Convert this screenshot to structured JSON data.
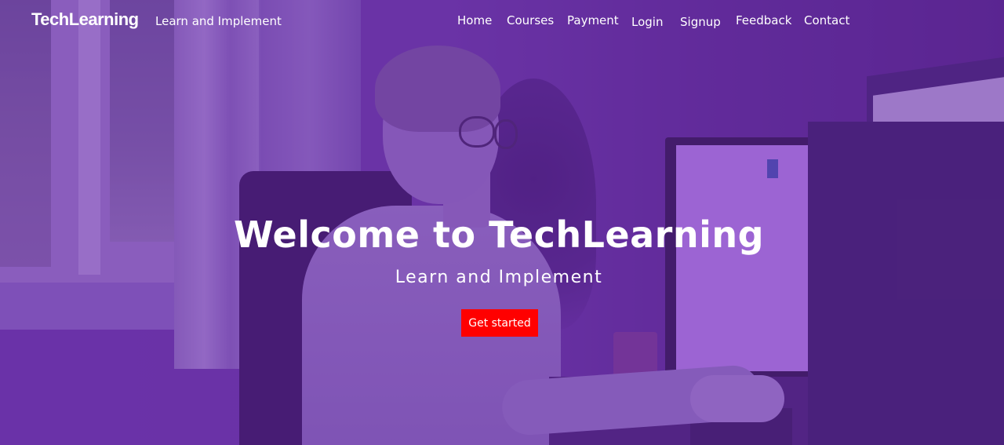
{
  "brand": {
    "name": "TechLearning",
    "tagline": "Learn and Implement"
  },
  "nav": {
    "items": [
      {
        "label": "Home"
      },
      {
        "label": "Courses"
      },
      {
        "label": "Payment"
      },
      {
        "label": "Login"
      },
      {
        "label": "Signup"
      },
      {
        "label": "Feedback"
      },
      {
        "label": "Contact"
      }
    ]
  },
  "hero": {
    "title": "Welcome to TechLearning",
    "subtitle": "Learn and Implement",
    "cta_label": "Get started",
    "background_image": "person-at-computer-photo"
  },
  "colors": {
    "overlay": "#6a2bb0",
    "cta_background": "#ff0000",
    "text": "#ffffff"
  }
}
